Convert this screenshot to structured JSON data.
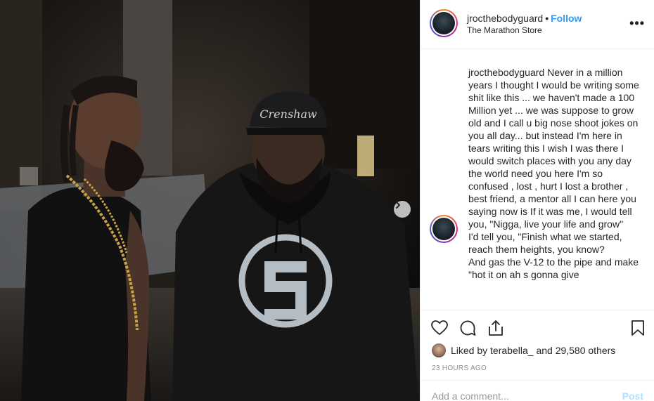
{
  "post": {
    "username": "jrocthebodyguard",
    "separator": "•",
    "follow_label": "Follow",
    "location": "The Marathon Store",
    "more_icon": "more-options-icon",
    "more_label": "•••"
  },
  "caption": {
    "username": "jrocthebodyguard",
    "text": " Never in a million years I thought I would be writing some shit like this ... we haven't made a 100 Million yet ... we was suppose to grow old and I call u big nose shoot jokes on you all day... but instead I'm here in tears writing this I wish I was there I would switch places with you any day the world need you here I'm so confused , lost , hurt I lost a brother , best friend, a mentor all I can here you saying now is If it was me, I would tell you, \"Nigga, live your life and grow\"\nI'd tell you, \"Finish what we started, reach them heights, you know?\nAnd gas the V-12 to the pipe and make \"hot it on ah s gonna give"
  },
  "photo": {
    "cap_text": "Crenshaw",
    "shirt_logo": "A 5"
  },
  "actions": {
    "like_icon": "heart-icon",
    "comment_icon": "comment-icon",
    "share_icon": "share-icon",
    "save_icon": "bookmark-icon"
  },
  "likes": {
    "prefix": "Liked by ",
    "user": "terabella_",
    "middle": " and ",
    "count": "29,580 others"
  },
  "timestamp": "23 HOURS AGO",
  "comment": {
    "placeholder": "Add a comment...",
    "post_label": "Post"
  },
  "colors": {
    "accent": "#3897f0",
    "post_disabled": "#b2dffc",
    "muted": "#8e8e8e"
  }
}
